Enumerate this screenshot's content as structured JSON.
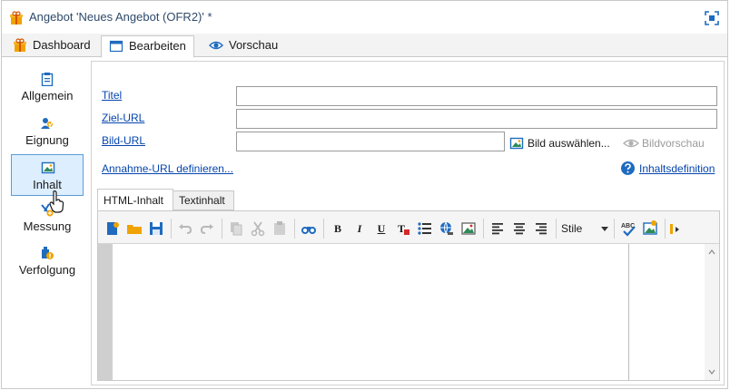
{
  "window": {
    "title": "Angebot 'Neues Angebot (OFR2)' *"
  },
  "tabs": [
    {
      "label": "Dashboard",
      "icon": "gift-icon"
    },
    {
      "label": "Bearbeiten",
      "icon": "window-icon",
      "active": true
    },
    {
      "label": "Vorschau",
      "icon": "eye-icon"
    }
  ],
  "sidebar": {
    "items": [
      {
        "label": "Allgemein",
        "icon": "clipboard-icon"
      },
      {
        "label": "Eignung",
        "icon": "users-icon"
      },
      {
        "label": "Inhalt",
        "icon": "image-icon",
        "active": true
      },
      {
        "label": "Messung",
        "icon": "measure-icon"
      },
      {
        "label": "Verfolgung",
        "icon": "tracking-icon"
      }
    ]
  },
  "form": {
    "titel_label": "Titel",
    "titel_value": "",
    "ziel_url_label": "Ziel-URL",
    "ziel_url_value": "",
    "bild_url_label": "Bild-URL",
    "bild_url_value": "",
    "bild_pick_label": "Bild auswählen...",
    "bild_preview_label": "Bildvorschau",
    "annahme_label": "Annahme-URL definieren...",
    "inhaltsdef_label": "Inhaltsdefinition"
  },
  "editor": {
    "tabs": [
      {
        "label": "HTML-Inhalt",
        "active": true
      },
      {
        "label": "Textinhalt"
      }
    ],
    "styles_label": "Stile",
    "toolbar_icons": [
      "new-icon",
      "open-folder-icon",
      "save-icon",
      "undo-icon",
      "redo-icon",
      "copy-icon",
      "cut-icon",
      "paste-icon",
      "find-icon",
      "bold-icon",
      "italic-icon",
      "underline-icon",
      "text-color-icon",
      "list-icon",
      "link-icon",
      "image-insert-icon",
      "align-left-icon",
      "align-center-icon",
      "align-right-icon",
      "spellcheck-icon",
      "insert-picture-icon",
      "more-icon"
    ],
    "content": ""
  },
  "colors": {
    "accent": "#5a9bd6",
    "link": "#0645ad",
    "icon_blue": "#1e6bbf",
    "icon_orange": "#f0a300"
  }
}
